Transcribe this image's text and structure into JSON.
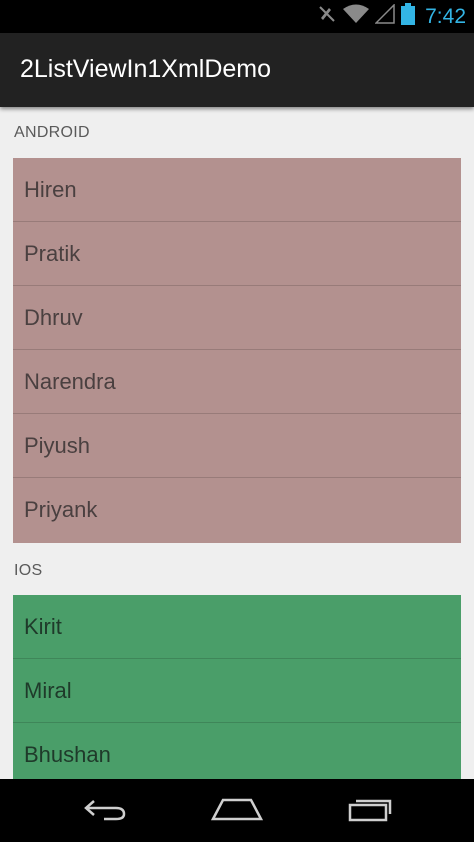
{
  "status_bar": {
    "time": "7:42",
    "icons": [
      "mute-icon",
      "wifi-icon",
      "signal-icon",
      "battery-icon"
    ],
    "accent_color": "#33b5e5"
  },
  "action_bar": {
    "title": "2ListViewIn1XmlDemo"
  },
  "sections": [
    {
      "header": "ANDROID",
      "color": "#b3918f",
      "items": [
        "Hiren",
        "Pratik",
        "Dhruv",
        "Narendra",
        "Piyush",
        "Priyank"
      ]
    },
    {
      "header": "IOS",
      "color": "#4a9e69",
      "items": [
        "Kirit",
        "Miral",
        "Bhushan"
      ]
    }
  ],
  "nav_bar": {
    "buttons": [
      "back-icon",
      "home-icon",
      "recent-apps-icon"
    ]
  }
}
